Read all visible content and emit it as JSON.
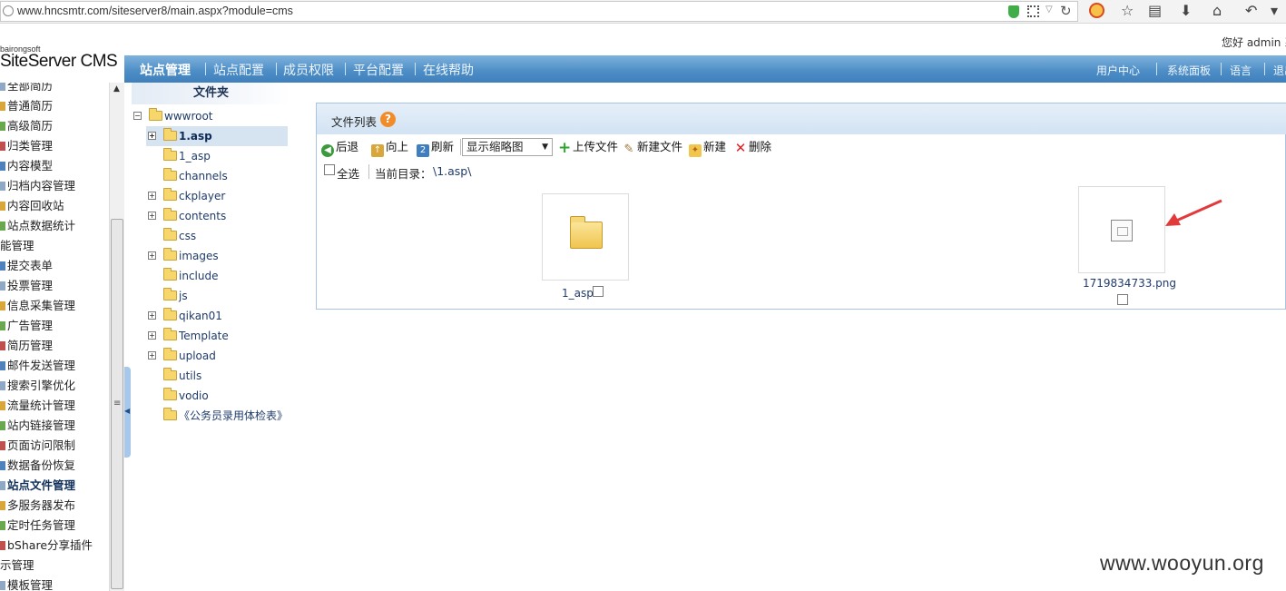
{
  "browser": {
    "url": "www.hncsmtr.com/siteserver8/main.aspx?module=cms"
  },
  "header": {
    "brand_small": "bairongsoft",
    "brand_big": "SiteServer CMS",
    "greeting": "您好 admin 系",
    "nav": [
      "站点管理",
      "站点配置",
      "成员权限",
      "平台配置",
      "在线帮助"
    ],
    "nav_right": [
      "用户中心",
      "系统面板",
      "语言",
      "退出"
    ]
  },
  "sidebar": {
    "items": [
      {
        "label": "全部简历",
        "type": "item"
      },
      {
        "label": "普通简历",
        "type": "item"
      },
      {
        "label": "高级简历",
        "type": "item"
      },
      {
        "label": "归类管理",
        "type": "item"
      },
      {
        "label": "内容模型",
        "type": "item"
      },
      {
        "label": "归档内容管理",
        "type": "item"
      },
      {
        "label": "内容回收站",
        "type": "item"
      },
      {
        "label": "站点数据统计",
        "type": "item"
      },
      {
        "label": "能管理",
        "type": "group"
      },
      {
        "label": "提交表单",
        "type": "item"
      },
      {
        "label": "投票管理",
        "type": "item"
      },
      {
        "label": "信息采集管理",
        "type": "item"
      },
      {
        "label": "广告管理",
        "type": "item"
      },
      {
        "label": "简历管理",
        "type": "item"
      },
      {
        "label": "邮件发送管理",
        "type": "item"
      },
      {
        "label": "搜索引擎优化",
        "type": "item"
      },
      {
        "label": "流量统计管理",
        "type": "item"
      },
      {
        "label": "站内链接管理",
        "type": "item"
      },
      {
        "label": "页面访问限制",
        "type": "item"
      },
      {
        "label": "数据备份恢复",
        "type": "item"
      },
      {
        "label": "站点文件管理",
        "type": "current"
      },
      {
        "label": "多服务器发布",
        "type": "item"
      },
      {
        "label": "定时任务管理",
        "type": "item"
      },
      {
        "label": "bShare分享插件",
        "type": "item"
      },
      {
        "label": "示管理",
        "type": "group"
      },
      {
        "label": "模板管理",
        "type": "item"
      }
    ]
  },
  "tree": {
    "header": "文件夹",
    "root": "wwwroot",
    "nodes": [
      {
        "label": "1.asp",
        "expandable": true,
        "selected": true
      },
      {
        "label": "1_asp",
        "expandable": false,
        "selected": false
      },
      {
        "label": "channels",
        "expandable": false,
        "selected": false
      },
      {
        "label": "ckplayer",
        "expandable": true,
        "selected": false
      },
      {
        "label": "contents",
        "expandable": true,
        "selected": false
      },
      {
        "label": "css",
        "expandable": false,
        "selected": false
      },
      {
        "label": "images",
        "expandable": true,
        "selected": false
      },
      {
        "label": "include",
        "expandable": false,
        "selected": false
      },
      {
        "label": "js",
        "expandable": false,
        "selected": false
      },
      {
        "label": "qikan01",
        "expandable": true,
        "selected": false
      },
      {
        "label": "Template",
        "expandable": true,
        "selected": false
      },
      {
        "label": "upload",
        "expandable": true,
        "selected": false
      },
      {
        "label": "utils",
        "expandable": false,
        "selected": false
      },
      {
        "label": "vodio",
        "expandable": false,
        "selected": false
      },
      {
        "label": "《公务员录用体检表》",
        "expandable": false,
        "selected": false
      }
    ]
  },
  "filelist": {
    "title": "文件列表",
    "toolbar": {
      "back": "后退",
      "up": "向上",
      "refresh": "刷新",
      "view": "显示缩略图",
      "upload": "上传文件",
      "new_file": "新建文件",
      "new": "新建",
      "delete": "删除"
    },
    "select_all": "全选",
    "current_dir_label": "当前目录：",
    "current_dir": "\\1.asp\\",
    "files": [
      {
        "name": "1_asp",
        "kind": "folder"
      },
      {
        "name": "1719834733.png",
        "kind": "image"
      }
    ]
  },
  "watermark": "www.wooyun.org",
  "colors": {
    "nav_blue": "#4f8fc7",
    "panel_border": "#a9c4e0",
    "annotation_red": "#e23a3a"
  }
}
